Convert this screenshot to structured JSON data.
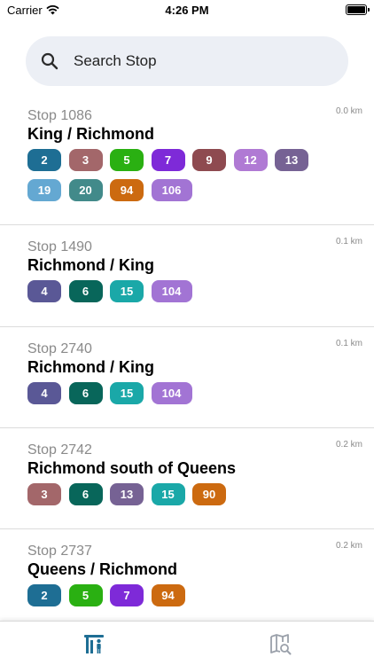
{
  "status": {
    "carrier": "Carrier",
    "time": "4:26 PM"
  },
  "search": {
    "placeholder": "Search Stop"
  },
  "stops": [
    {
      "id_label": "Stop 1086",
      "name": "King / Richmond",
      "distance": "0.0 km",
      "routes": [
        {
          "label": "2",
          "color": "#1e6e94"
        },
        {
          "label": "3",
          "color": "#a3676a"
        },
        {
          "label": "5",
          "color": "#2ab012"
        },
        {
          "label": "7",
          "color": "#7e2ad8"
        },
        {
          "label": "9",
          "color": "#8e4a50"
        },
        {
          "label": "12",
          "color": "#b07ad4"
        },
        {
          "label": "13",
          "color": "#766294"
        },
        {
          "label": "19",
          "color": "#64a8d2"
        },
        {
          "label": "20",
          "color": "#428a8a"
        },
        {
          "label": "94",
          "color": "#cc6a10"
        },
        {
          "label": "106",
          "color": "#a274d4"
        }
      ]
    },
    {
      "id_label": "Stop 1490",
      "name": "Richmond / King",
      "distance": "0.1 km",
      "routes": [
        {
          "label": "4",
          "color": "#5a5896"
        },
        {
          "label": "6",
          "color": "#08665a"
        },
        {
          "label": "15",
          "color": "#1aa8a8"
        },
        {
          "label": "104",
          "color": "#a274d4"
        }
      ]
    },
    {
      "id_label": "Stop 2740",
      "name": "Richmond / King",
      "distance": "0.1 km",
      "routes": [
        {
          "label": "4",
          "color": "#5a5896"
        },
        {
          "label": "6",
          "color": "#08665a"
        },
        {
          "label": "15",
          "color": "#1aa8a8"
        },
        {
          "label": "104",
          "color": "#a274d4"
        }
      ]
    },
    {
      "id_label": "Stop 2742",
      "name": "Richmond south of Queens",
      "distance": "0.2 km",
      "routes": [
        {
          "label": "3",
          "color": "#a3676a"
        },
        {
          "label": "6",
          "color": "#08665a"
        },
        {
          "label": "13",
          "color": "#766294"
        },
        {
          "label": "15",
          "color": "#1aa8a8"
        },
        {
          "label": "90",
          "color": "#cc6a10"
        }
      ]
    },
    {
      "id_label": "Stop 2737",
      "name": "Queens / Richmond",
      "distance": "0.2 km",
      "routes": [
        {
          "label": "2",
          "color": "#1e6e94"
        },
        {
          "label": "5",
          "color": "#2ab012"
        },
        {
          "label": "7",
          "color": "#7e2ad8"
        },
        {
          "label": "94",
          "color": "#cc6a10"
        }
      ]
    }
  ],
  "tabs": [
    {
      "icon": "stops-icon",
      "active": true,
      "color": "#1e6e94"
    },
    {
      "icon": "map-search-icon",
      "active": false,
      "color": "#9aa0aa"
    }
  ]
}
